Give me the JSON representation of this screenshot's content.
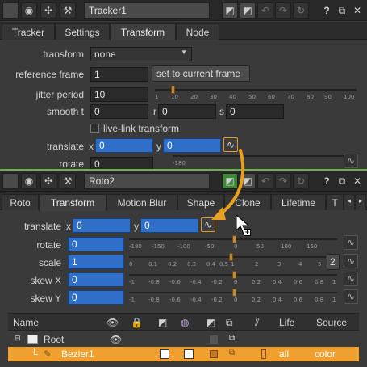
{
  "tracker_panel": {
    "node_name": "Tracker1",
    "tabs": [
      "Tracker",
      "Settings",
      "Transform",
      "Node"
    ],
    "active_tab": "Transform",
    "transform_label": "transform",
    "transform_value": "none",
    "reference_frame_label": "reference frame",
    "reference_frame_value": "1",
    "set_current_frame_label": "set to current frame",
    "jitter_period_label": "jitter period",
    "jitter_period_value": "10",
    "jitter_ticks": [
      "1",
      "10",
      "20",
      "30",
      "40",
      "50",
      "60",
      "70",
      "80",
      "90",
      "100"
    ],
    "smooth_label": "smooth t",
    "smooth_t_value": "0",
    "smooth_r_label": "r",
    "smooth_r_value": "0",
    "smooth_s_label": "s",
    "smooth_s_value": "0",
    "live_link_label": "live-link transform",
    "live_link_checked": false,
    "translate_label": "translate",
    "translate_x_label": "x",
    "translate_x_value": "0",
    "translate_y_label": "y",
    "translate_y_value": "0",
    "rotate_label": "rotate",
    "rotate_value": "0",
    "rotate_ticks": [
      "-180",
      "-135",
      "-90",
      "-45",
      "0",
      "45",
      "90",
      "135",
      "180"
    ]
  },
  "roto_panel": {
    "node_name": "Roto2",
    "tabs": [
      "Roto",
      "Transform",
      "Motion Blur",
      "Shape",
      "Clone",
      "Lifetime",
      "T"
    ],
    "active_tab": "Transform",
    "translate_label": "translate",
    "translate_x_label": "x",
    "translate_x_value": "0",
    "translate_y_label": "y",
    "translate_y_value": "0",
    "rotate_label": "rotate",
    "rotate_value": "0",
    "rotate_ticks": [
      "-180",
      "-150",
      "-100",
      "-50",
      "0",
      "50",
      "100",
      "150"
    ],
    "scale_label": "scale",
    "scale_value": "1",
    "scale_channel_button": "2",
    "scale_ticks": [
      "0",
      "0.1",
      "0.2",
      "0.3",
      "0.4",
      "0.5",
      "1",
      "2",
      "3",
      "4",
      "5"
    ],
    "skew_x_label": "skew X",
    "skew_x_value": "0",
    "skew_y_label": "skew Y",
    "skew_y_value": "0",
    "skew_ticks": [
      "-1",
      "-0.8",
      "-0.6",
      "-0.4",
      "-0.2",
      "0",
      "0.2",
      "0.4",
      "0.6",
      "0.8",
      "1"
    ],
    "table": {
      "headers": {
        "name": "Name",
        "life": "Life",
        "source": "Source"
      },
      "rows": [
        {
          "name": "Root",
          "life": "",
          "source": ""
        },
        {
          "name": "Bezier1",
          "life": "all",
          "source": "color"
        }
      ]
    }
  },
  "colors": {
    "accent_blue": "#2f6ec9",
    "selected_row_orange": "#f0a030",
    "divider_green": "#6bb34a",
    "drag_arrow_orange": "#e8a020"
  },
  "drag_indicator_symbol": "+"
}
